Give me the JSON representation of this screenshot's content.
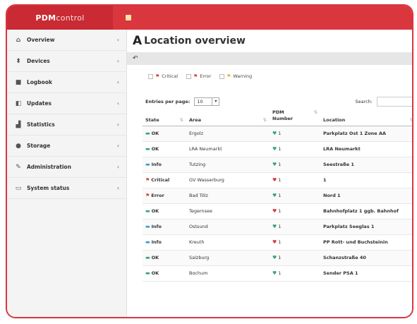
{
  "app": {
    "brand_bold": "PDM",
    "brand_rest": " control"
  },
  "sidebar": {
    "items": [
      {
        "label": "Overview",
        "icon": "home-icon",
        "glyph": "⌂"
      },
      {
        "label": "Devices",
        "icon": "device-icon",
        "glyph": "⬍"
      },
      {
        "label": "Logbook",
        "icon": "book-icon",
        "glyph": "■"
      },
      {
        "label": "Updates",
        "icon": "update-icon",
        "glyph": "◧"
      },
      {
        "label": "Statistics",
        "icon": "chart-icon",
        "glyph": "▟"
      },
      {
        "label": "Storage",
        "icon": "storage-icon",
        "glyph": "●"
      },
      {
        "label": "Administration",
        "icon": "wrench-icon",
        "glyph": "✎"
      },
      {
        "label": "System status",
        "icon": "monitor-icon",
        "glyph": "▭"
      }
    ]
  },
  "page": {
    "title": "Location overview",
    "title_icon": "A"
  },
  "filters": [
    {
      "label": "Critical",
      "color": "#d9363e"
    },
    {
      "label": "Error",
      "color": "#d9363e"
    },
    {
      "label": "Warning",
      "color": "#f0a830"
    }
  ],
  "controls": {
    "entries_label": "Entries per page:",
    "entries_value": "10",
    "search_label": "Search:",
    "search_value": ""
  },
  "table": {
    "headers": [
      "State",
      "Area",
      "PDM Number",
      "Location"
    ],
    "rows": [
      {
        "state": "OK",
        "state_color": "#3a9a8a",
        "area": "Ergolz",
        "number": "1",
        "heart_color": "#3aa088",
        "location": "Parkplatz Ost 1 Zone AA"
      },
      {
        "state": "OK",
        "state_color": "#3a9a8a",
        "area": "LRA Neumarkt",
        "number": "1",
        "heart_color": "#3aa088",
        "location": "LRA Neumarkt"
      },
      {
        "state": "Info",
        "state_color": "#3a9ad0",
        "area": "Tutzing",
        "number": "1",
        "heart_color": "#3aa088",
        "location": "Seestraße 1"
      },
      {
        "state": "Critical",
        "state_color": "#d9363e",
        "area": "GV Wasserburg",
        "number": "1",
        "heart_color": "#d9363e",
        "location": "1"
      },
      {
        "state": "Error",
        "state_color": "#d9363e",
        "area": "Bad Tölz",
        "number": "1",
        "heart_color": "#3aa088",
        "location": "Nord 1"
      },
      {
        "state": "OK",
        "state_color": "#3a9a8a",
        "area": "Tegernsee",
        "number": "1",
        "heart_color": "#d9363e",
        "location": "Bahnhofplatz 1 ggb. Bahnhof"
      },
      {
        "state": "Info",
        "state_color": "#3a9ad0",
        "area": "Ostsund",
        "number": "1",
        "heart_color": "#3aa088",
        "location": "Parkplatz Seeglas 1"
      },
      {
        "state": "Info",
        "state_color": "#3a9ad0",
        "area": "Kreuth",
        "number": "1",
        "heart_color": "#d9363e",
        "location": "PP Rott- und Buchsteinin"
      },
      {
        "state": "OK",
        "state_color": "#3a9a8a",
        "area": "Salzburg",
        "number": "1",
        "heart_color": "#3aa088",
        "location": "Schanzstraße 40"
      },
      {
        "state": "OK",
        "state_color": "#3a9a8a",
        "area": "Bochum",
        "number": "1",
        "heart_color": "#3aa088",
        "location": "Sender PSA 1"
      }
    ]
  }
}
